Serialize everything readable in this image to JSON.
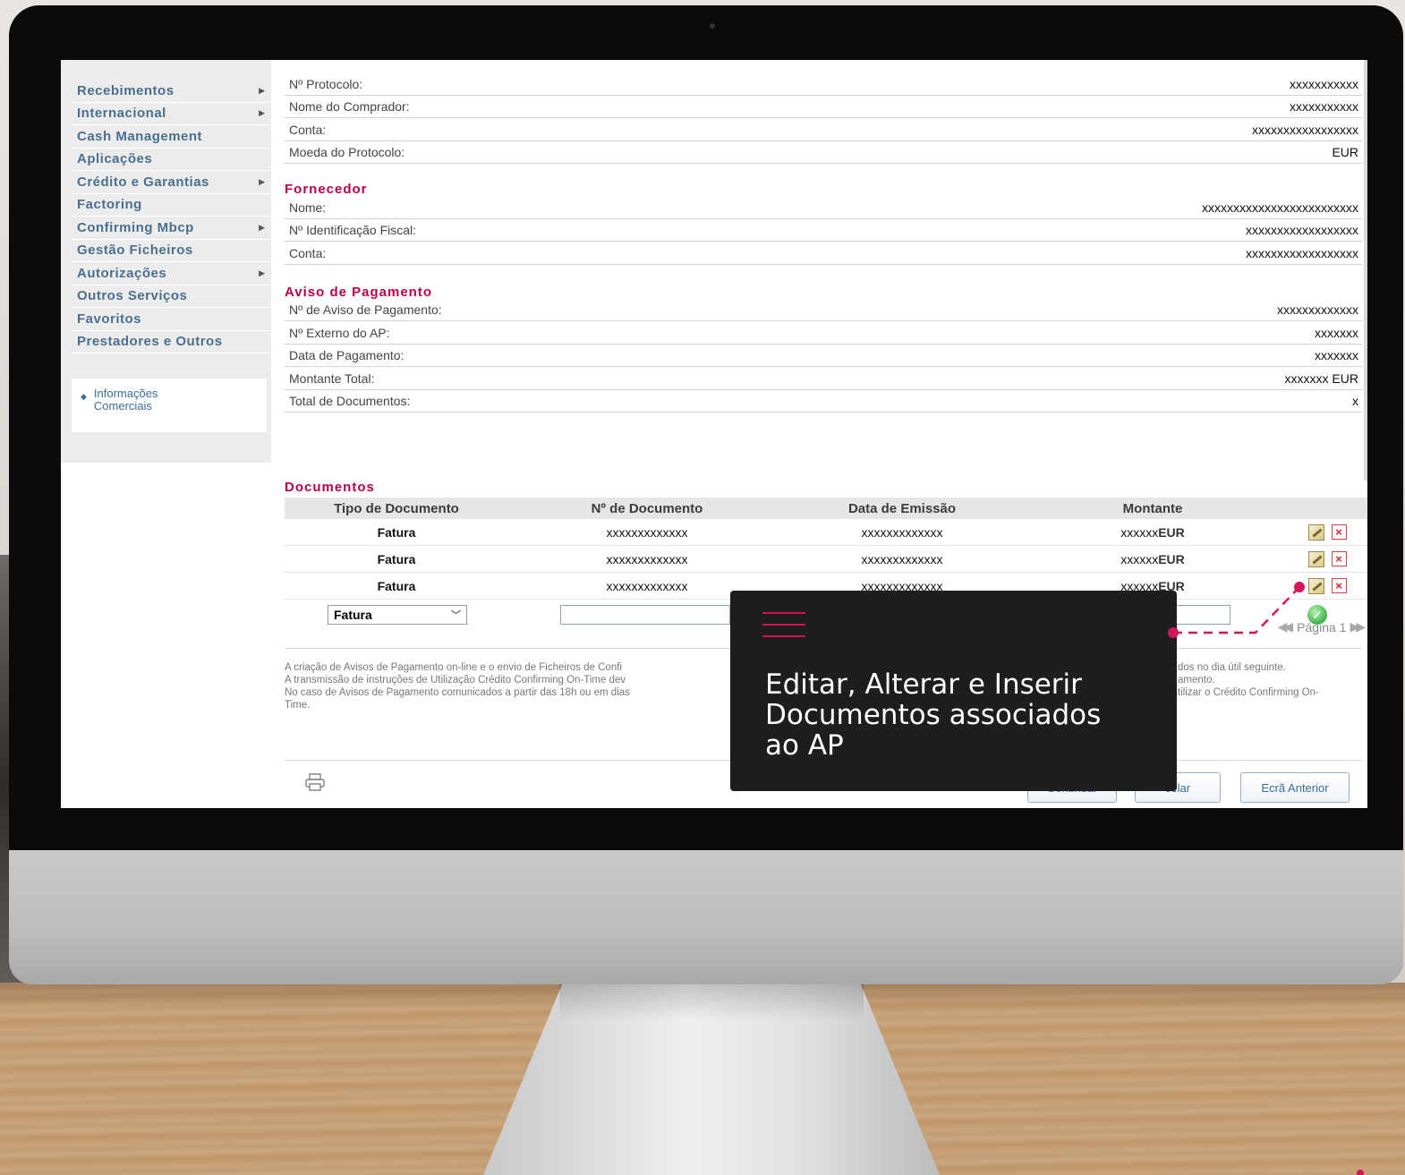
{
  "sidebar": {
    "items": [
      {
        "label": "Recebimentos",
        "arrow": true
      },
      {
        "label": "Internacional",
        "arrow": true
      },
      {
        "label": "Cash Management",
        "arrow": false
      },
      {
        "label": "Aplicações",
        "arrow": false
      },
      {
        "label": "Crédito e Garantias",
        "arrow": true
      },
      {
        "label": "Factoring",
        "arrow": false
      },
      {
        "label": "Confirming Mbcp",
        "arrow": true
      },
      {
        "label": "Gestão Ficheiros",
        "arrow": false
      },
      {
        "label": "Autorizações",
        "arrow": true
      },
      {
        "label": "Outros Serviços",
        "arrow": false
      },
      {
        "label": "Favoritos",
        "arrow": false
      },
      {
        "label": "Prestadores e Outros",
        "arrow": false
      }
    ],
    "info_link": "Informações Comerciais"
  },
  "protocol": {
    "rows": [
      {
        "label": "Nº Protocolo:",
        "value": "xxxxxxxxxxx"
      },
      {
        "label": "Nome do Comprador:",
        "value": "xxxxxxxxxxx"
      },
      {
        "label": "Conta:",
        "value": "xxxxxxxxxxxxxxxxx"
      },
      {
        "label": "Moeda do Protocolo:",
        "value": "EUR"
      }
    ]
  },
  "fornecedor": {
    "title": "Fornecedor",
    "rows": [
      {
        "label": "Nome:",
        "value": "xxxxxxxxxxxxxxxxxxxxxxxxx"
      },
      {
        "label": "Nº Identificação Fiscal:",
        "value": "xxxxxxxxxxxxxxxxxx"
      },
      {
        "label": "Conta:",
        "value": "xxxxxxxxxxxxxxxxxx"
      }
    ]
  },
  "aviso": {
    "title": "Aviso de Pagamento",
    "rows": [
      {
        "label": "Nº de Aviso de Pagamento:",
        "value": "xxxxxxxxxxxxx"
      },
      {
        "label": "Nº Externo do AP:",
        "value": "xxxxxxx"
      },
      {
        "label": "Data de Pagamento:",
        "value": "xxxxxxx"
      },
      {
        "label": "Montante Total:",
        "value": "xxxxxxx EUR"
      },
      {
        "label": "Total de Documentos:",
        "value": "x"
      }
    ]
  },
  "documentos": {
    "title": "Documentos",
    "columns": [
      "Tipo de Documento",
      "Nº de Documento",
      "Data de Emissão",
      "Montante"
    ],
    "rows": [
      {
        "tipo": "Fatura",
        "numero": "xxxxxxxxxxxxx",
        "data": "xxxxxxxxxxxxx",
        "montante": "xxxxxx",
        "moeda": "EUR"
      },
      {
        "tipo": "Fatura",
        "numero": "xxxxxxxxxxxxx",
        "data": "xxxxxxxxxxxxx",
        "montante": "xxxxxx",
        "moeda": "EUR"
      },
      {
        "tipo": "Fatura",
        "numero": "xxxxxxxxxxxxx",
        "data": "xxxxxxxxxxxxx",
        "montante": "xxxxxx",
        "moeda": "EUR"
      }
    ],
    "new_row_type": "Fatura",
    "pager": "Página 1"
  },
  "notes": [
    "A criação de Avisos de Pagamento on-line e o envio de Ficheiros de Confi",
    "A transmissão de instruções de Utilização Crédito Confirming On-Time dev",
    "No caso de Avisos de Pagamento comunicados a partir das 18h ou em dias",
    "Time."
  ],
  "notes_right": [
    "dos no dia útil seguinte.",
    "amento.",
    "tilizar o Crédito Confirming On-",
    ""
  ],
  "buttons": {
    "continuar": "Continuar",
    "cancelar": "celar",
    "anterior": "Ecrã Anterior"
  },
  "tooltip": {
    "text": "Editar, Alterar e Inserir Documentos associados ao AP"
  },
  "colors": {
    "accent": "#b8004b",
    "link": "#3b6d9e",
    "tooltip_bg": "#1e1e1e",
    "connector": "#d4145a"
  }
}
